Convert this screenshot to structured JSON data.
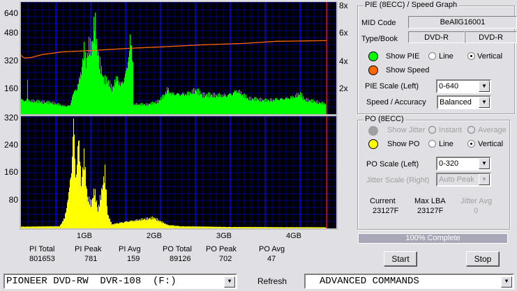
{
  "chart_data": [
    {
      "type": "bar",
      "name_top": "PIE",
      "xlabel": "",
      "xlim": [
        0,
        4.5
      ],
      "x_ticks": [
        "1GB",
        "2GB",
        "3GB",
        "4GB"
      ],
      "ylim": [
        0,
        640
      ],
      "y_ticks": [
        "640",
        "480",
        "320",
        "160"
      ],
      "y2lim": [
        0,
        8
      ],
      "y2_ticks": [
        "8x",
        "6x",
        "4x",
        "2x"
      ],
      "grid": true,
      "end_marker_gb": 4.38,
      "pie_points": [
        [
          0,
          90
        ],
        [
          0.03,
          80
        ],
        [
          0.08,
          85
        ],
        [
          0.09,
          210
        ],
        [
          0.1,
          80
        ],
        [
          0.3,
          70
        ],
        [
          0.45,
          65
        ],
        [
          0.55,
          55
        ],
        [
          0.6,
          50
        ],
        [
          0.7,
          50
        ],
        [
          0.73,
          110
        ],
        [
          0.8,
          160
        ],
        [
          0.85,
          230
        ],
        [
          0.9,
          380
        ],
        [
          0.93,
          300
        ],
        [
          0.97,
          400
        ],
        [
          1.0,
          380
        ],
        [
          1.03,
          440
        ],
        [
          1.05,
          560
        ],
        [
          1.08,
          400
        ],
        [
          1.12,
          300
        ],
        [
          1.18,
          200
        ],
        [
          1.25,
          190
        ],
        [
          1.3,
          150
        ],
        [
          1.38,
          220
        ],
        [
          1.42,
          170
        ],
        [
          1.48,
          220
        ],
        [
          1.52,
          280
        ],
        [
          1.56,
          450
        ],
        [
          1.6,
          300
        ],
        [
          1.61,
          60
        ],
        [
          1.8,
          55
        ],
        [
          1.95,
          70
        ],
        [
          2.05,
          110
        ],
        [
          2.1,
          150
        ],
        [
          2.15,
          120
        ],
        [
          2.4,
          120
        ],
        [
          2.5,
          140
        ],
        [
          2.6,
          110
        ],
        [
          2.9,
          110
        ],
        [
          3.0,
          120
        ],
        [
          3.1,
          140
        ],
        [
          3.25,
          90
        ],
        [
          3.5,
          80
        ],
        [
          3.7,
          90
        ],
        [
          3.9,
          100
        ],
        [
          4.0,
          120
        ],
        [
          4.05,
          85
        ],
        [
          4.3,
          65
        ],
        [
          4.38,
          60
        ]
      ],
      "speed_points": [
        [
          0,
          4.2
        ],
        [
          0.05,
          4.0
        ],
        [
          0.15,
          4.05
        ],
        [
          0.3,
          4.25
        ],
        [
          0.6,
          4.45
        ],
        [
          1.05,
          4.55
        ],
        [
          1.55,
          4.7
        ],
        [
          2.0,
          4.8
        ],
        [
          2.6,
          4.95
        ],
        [
          3.2,
          5.05
        ],
        [
          3.65,
          5.2
        ],
        [
          4.38,
          5.25
        ]
      ]
    },
    {
      "type": "bar",
      "name": "PO",
      "xlim": [
        0,
        4.5
      ],
      "ylim": [
        0,
        320
      ],
      "y_ticks": [
        "320",
        "240",
        "160",
        "80"
      ],
      "grid": true,
      "end_marker_gb": 4.38,
      "po_points": [
        [
          0,
          5
        ],
        [
          0.55,
          6
        ],
        [
          0.62,
          30
        ],
        [
          0.68,
          100
        ],
        [
          0.72,
          180
        ],
        [
          0.75,
          320
        ],
        [
          0.78,
          150
        ],
        [
          0.82,
          270
        ],
        [
          0.86,
          140
        ],
        [
          0.9,
          210
        ],
        [
          0.95,
          90
        ],
        [
          1.0,
          70
        ],
        [
          1.05,
          110
        ],
        [
          1.1,
          50
        ],
        [
          1.2,
          160
        ],
        [
          1.24,
          40
        ],
        [
          1.3,
          12
        ],
        [
          1.5,
          20
        ],
        [
          1.7,
          25
        ],
        [
          1.9,
          30
        ],
        [
          2.1,
          10
        ],
        [
          2.3,
          6
        ],
        [
          3.0,
          4
        ],
        [
          4.38,
          3
        ]
      ]
    }
  ],
  "colors": {
    "pie": "#00ff00",
    "speed": "#ff6600",
    "po": "#ffff00",
    "grid_minor": "#000080",
    "grid_major": "#0000ff",
    "end_marker": "#ff0000"
  },
  "stats": {
    "labels": [
      "PI Total",
      "PI Peak",
      "PI Avg",
      "PO Total",
      "PO Peak",
      "PO Avg"
    ],
    "values": [
      "801653",
      "781",
      "159",
      "89126",
      "702",
      "47"
    ]
  },
  "pie_group": {
    "title": "PIE (8ECC) / Speed Graph",
    "mid_label": "MID Code",
    "mid_value": "BeAllG16001",
    "type_label": "Type/Book",
    "type_value": "DVD-R",
    "book_value": "DVD-R",
    "show_pie": "Show PIE",
    "line": "Line",
    "vertical": "Vertical",
    "show_speed": "Show Speed",
    "scale_label": "PIE Scale (Left)",
    "scale_value": "0-640",
    "speed_label": "Speed / Accuracy",
    "speed_value": "Balanced"
  },
  "po_group": {
    "title": "PO (8ECC)",
    "show_jitter": "Show Jitter",
    "instant": "Instant",
    "average": "Average",
    "show_po": "Show PO",
    "line": "Line",
    "vertical": "Vertical",
    "scale_label": "PO Scale (Left)",
    "scale_value": "0-320",
    "jitter_label": "Jitter Scale (Right)",
    "jitter_value": "Auto Peak",
    "current_label": "Current",
    "current_value": "23127F",
    "maxlba_label": "Max LBA",
    "maxlba_value": "23127F",
    "jitteravg_label": "Jitter Avg",
    "jitteravg_value": "0"
  },
  "progress": {
    "text": "100% Complete",
    "percent": 100
  },
  "buttons": {
    "start": "Start",
    "stop": "Stop",
    "refresh": "Refresh"
  },
  "drive": {
    "value": "PIONEER DVD-RW  DVR-108  (F:)"
  },
  "commands": {
    "value": "ADVANCED COMMANDS"
  }
}
